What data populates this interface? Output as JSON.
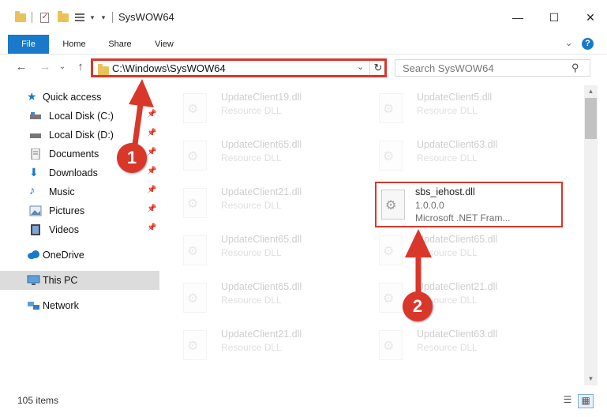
{
  "window": {
    "title": "SysWOW64",
    "minimize_label": "—",
    "maximize_label": "☐",
    "close_label": "✕"
  },
  "ribbon": {
    "tabs": [
      "File",
      "Home",
      "Share",
      "View"
    ],
    "help_label": "?",
    "collapse_label": "⌄"
  },
  "nav": {
    "back_label": "←",
    "forward_label": "→",
    "recent_label": "⌄",
    "up_label": "↑",
    "address": "C:\\Windows\\SysWOW64",
    "address_dropdown_label": "⌄",
    "refresh_label": "↻",
    "search_placeholder": "Search SysWOW64",
    "search_icon_label": "⚲"
  },
  "sidebar": {
    "quick_access": "Quick access",
    "pinned": [
      {
        "label": "Local Disk (C:)"
      },
      {
        "label": "Local Disk (D:)"
      },
      {
        "label": "Documents"
      },
      {
        "label": "Downloads"
      },
      {
        "label": "Music"
      },
      {
        "label": "Pictures"
      },
      {
        "label": "Videos"
      }
    ],
    "pin_glyph": "📌",
    "onedrive": "OneDrive",
    "thispc": "This PC",
    "network": "Network"
  },
  "files": {
    "left": [
      {
        "name": "UpdateClient19.dll",
        "type": "Resource DLL"
      },
      {
        "name": "UpdateClient65.dll",
        "type": "Resource DLL"
      },
      {
        "name": "UpdateClient21.dll",
        "type": "Resource DLL"
      },
      {
        "name": "UpdateClient65.dll",
        "type": "Resource DLL"
      },
      {
        "name": "UpdateClient65.dll",
        "type": "Resource DLL"
      },
      {
        "name": "UpdateClient21.dll",
        "type": "Resource DLL"
      }
    ],
    "right": [
      {
        "name": "UpdateClient5.dll",
        "type": "Resource DLL"
      },
      {
        "name": "UpdateClient63.dll",
        "type": "Resource DLL"
      },
      {
        "name": "UpdateClient65.dll",
        "type": "Resource DLL"
      },
      {
        "name": "UpdateClient21.dll",
        "type": "Resource DLL"
      },
      {
        "name": "UpdateClient63.dll",
        "type": "Resource DLL"
      }
    ],
    "highlighted": {
      "name": "sbs_iehost.dll",
      "version": "1.0.0.0",
      "description": "Microsoft .NET Fram..."
    }
  },
  "status": {
    "item_count": "105 items"
  },
  "annotations": {
    "step1": "1",
    "step2": "2",
    "color": "#d9372a"
  }
}
